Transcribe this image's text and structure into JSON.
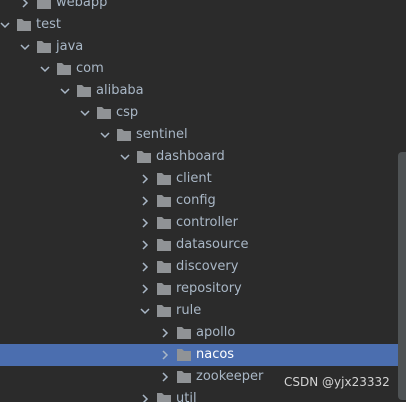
{
  "tree": {
    "items": [
      {
        "label": "webapp",
        "expanded": false,
        "depth": 1
      },
      {
        "label": "test",
        "expanded": true,
        "depth": 0
      },
      {
        "label": "java",
        "expanded": true,
        "depth": 1
      },
      {
        "label": "com",
        "expanded": true,
        "depth": 2
      },
      {
        "label": "alibaba",
        "expanded": true,
        "depth": 3
      },
      {
        "label": "csp",
        "expanded": true,
        "depth": 4
      },
      {
        "label": "sentinel",
        "expanded": true,
        "depth": 5
      },
      {
        "label": "dashboard",
        "expanded": true,
        "depth": 6
      },
      {
        "label": "client",
        "expanded": false,
        "depth": 7
      },
      {
        "label": "config",
        "expanded": false,
        "depth": 7
      },
      {
        "label": "controller",
        "expanded": false,
        "depth": 7
      },
      {
        "label": "datasource",
        "expanded": false,
        "depth": 7
      },
      {
        "label": "discovery",
        "expanded": false,
        "depth": 7
      },
      {
        "label": "repository",
        "expanded": false,
        "depth": 7
      },
      {
        "label": "rule",
        "expanded": true,
        "depth": 7
      },
      {
        "label": "apollo",
        "expanded": false,
        "depth": 8
      },
      {
        "label": "nacos",
        "expanded": false,
        "depth": 8,
        "selected": true
      },
      {
        "label": "zookeeper",
        "expanded": false,
        "depth": 8
      },
      {
        "label": "util",
        "expanded": false,
        "depth": 7
      }
    ]
  },
  "icons": {
    "expanded": "chevron-down-icon",
    "collapsed": "chevron-right-icon",
    "folder": "folder-icon"
  },
  "colors": {
    "background": "#2b2b2b",
    "text": "#a9b7c6",
    "selection": "#4b6eaf",
    "folder": "#909396",
    "arrow": "#a9b7c6"
  },
  "watermark": "CSDN @yjx23332"
}
